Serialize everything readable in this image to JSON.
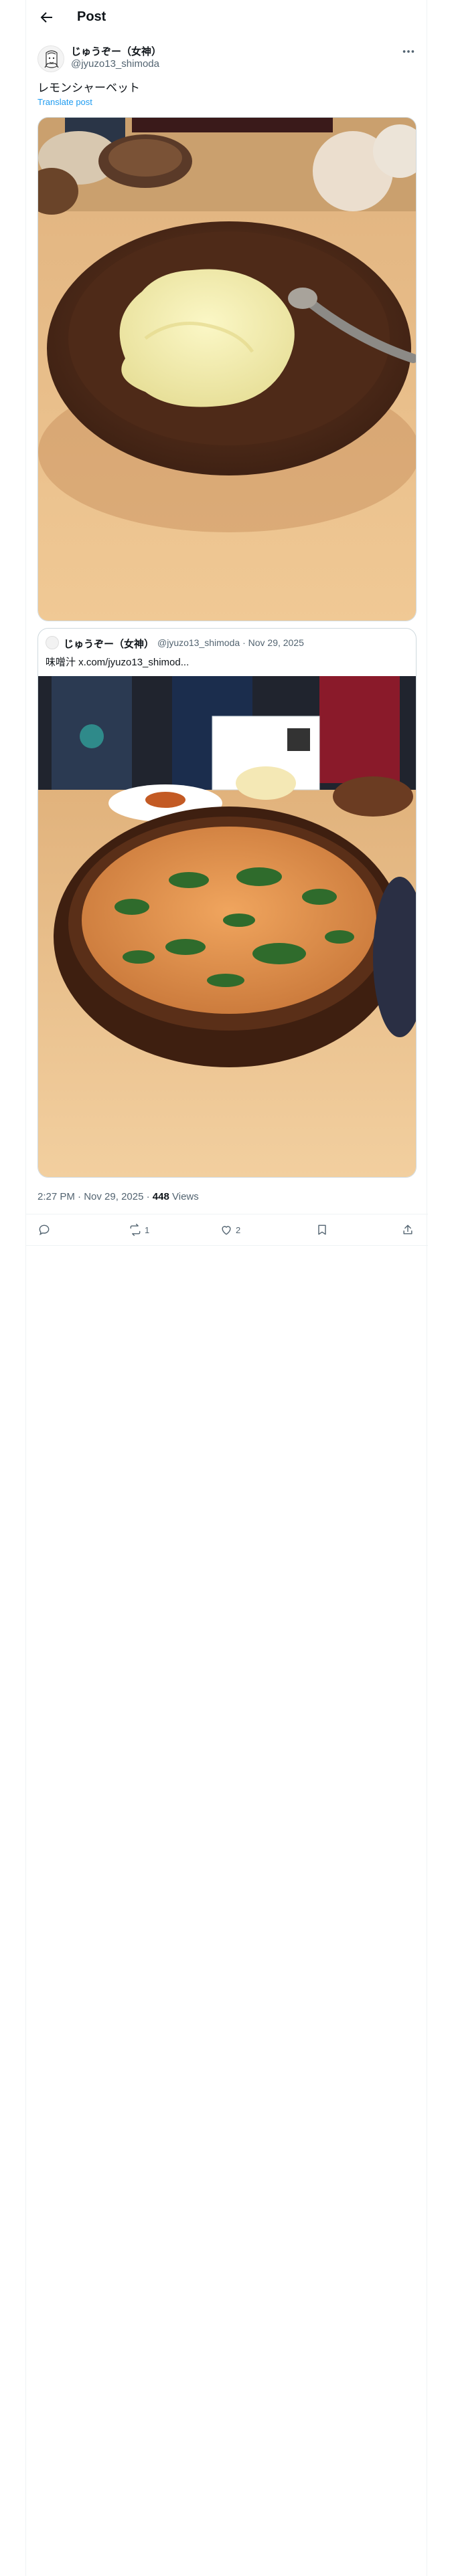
{
  "header": {
    "title": "Post"
  },
  "post": {
    "display_name": "じゅうぞー（女神）",
    "handle": "@jyuzo13_shimoda",
    "text": "レモンシャーベット",
    "translate_label": "Translate post",
    "image_description_icon": "sherbet-photo"
  },
  "quote": {
    "display_name": "じゅうぞー（女神）",
    "handle": "@jyuzo13_shimoda",
    "separator": "·",
    "date": "Nov 29, 2025",
    "text": "味噌汁 x.com/jyuzo13_shimod..."
  },
  "meta": {
    "time": "2:27 PM",
    "separator": "·",
    "date": "Nov 29, 2025",
    "views_count": "448",
    "views_label": "Views"
  },
  "actions": {
    "reply_count": "",
    "repost_count": "1",
    "like_count": "2",
    "bookmark_count": ""
  },
  "colors": {
    "accent": "#1d9bf0",
    "secondary_text": "#536471",
    "border": "#cfd9de"
  }
}
